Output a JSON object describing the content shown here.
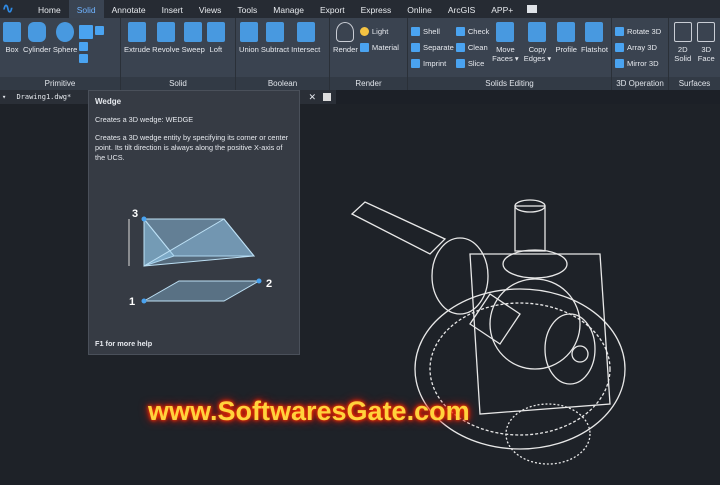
{
  "tabs": [
    "Home",
    "Solid",
    "Annotate",
    "Insert",
    "Views",
    "Tools",
    "Manage",
    "Export",
    "Express",
    "Online",
    "ArcGIS",
    "APP+"
  ],
  "active_tab": "Solid",
  "groups": {
    "primitive": {
      "label": "Primitive",
      "buttons": [
        "Box",
        "Cylinder",
        "Sphere"
      ]
    },
    "solid": {
      "label": "Solid",
      "buttons": [
        "Extrude",
        "Revolve",
        "Sweep",
        "Loft"
      ]
    },
    "boolean": {
      "label": "Boolean",
      "buttons": [
        "Union",
        "Subtract",
        "Intersect"
      ]
    },
    "render": {
      "label": "Render",
      "buttons": [
        "Render"
      ],
      "small": [
        "Light",
        "Material"
      ]
    },
    "solids_editing": {
      "label": "Solids Editing",
      "small1": [
        "Shell",
        "Separate",
        "Imprint"
      ],
      "small2": [
        "Check",
        "Clean",
        "Slice"
      ],
      "buttons": [
        "Move Faces ▾",
        "Copy Edges ▾",
        "Profile",
        "Flatshot"
      ]
    },
    "operation_3d": {
      "label": "3D Operation",
      "small": [
        "Rotate 3D",
        "Array 3D",
        "Mirror 3D"
      ]
    },
    "surfaces": {
      "label": "Surfaces",
      "buttons": [
        "2D Solid",
        "3D Face"
      ]
    }
  },
  "document_tab": "Drawing1.dwg*",
  "tooltip": {
    "title": "Wedge",
    "command": "Creates a 3D wedge: WEDGE",
    "description": "Creates a 3D wedge entity by specifying its corner or center point. Its tilt direction is always along the positive X-axis of the UCS.",
    "labels": [
      "1",
      "2",
      "3"
    ],
    "help": "F1 for more help"
  },
  "watermark": "www.SoftwaresGate.com",
  "colors": {
    "accent": "#4aa3f0",
    "ribbon": "#3a4350",
    "canvas": "#1e2228"
  }
}
